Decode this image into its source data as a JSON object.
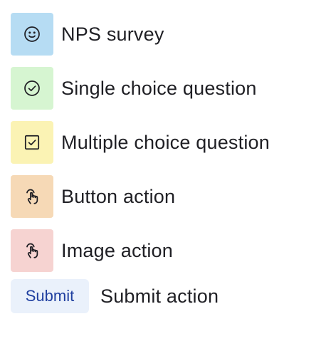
{
  "items": [
    {
      "label": "NPS survey",
      "icon": "smiley-icon",
      "tile_color": "#b6dcf3"
    },
    {
      "label": "Single choice question",
      "icon": "check-circle-icon",
      "tile_color": "#d6f5d1"
    },
    {
      "label": "Multiple choice question",
      "icon": "checkbox-icon",
      "tile_color": "#fbf3b4"
    },
    {
      "label": "Button action",
      "icon": "hand-pointer-icon",
      "tile_color": "#f6d9b6"
    },
    {
      "label": "Image action",
      "icon": "hand-pointer-icon",
      "tile_color": "#f6d3d1"
    }
  ],
  "submit": {
    "pill_label": "Submit",
    "label": "Submit action",
    "pill_background": "#eaf1fb",
    "pill_text_color": "#1f3fa0"
  },
  "icon_stroke_color": "#1f1f24"
}
